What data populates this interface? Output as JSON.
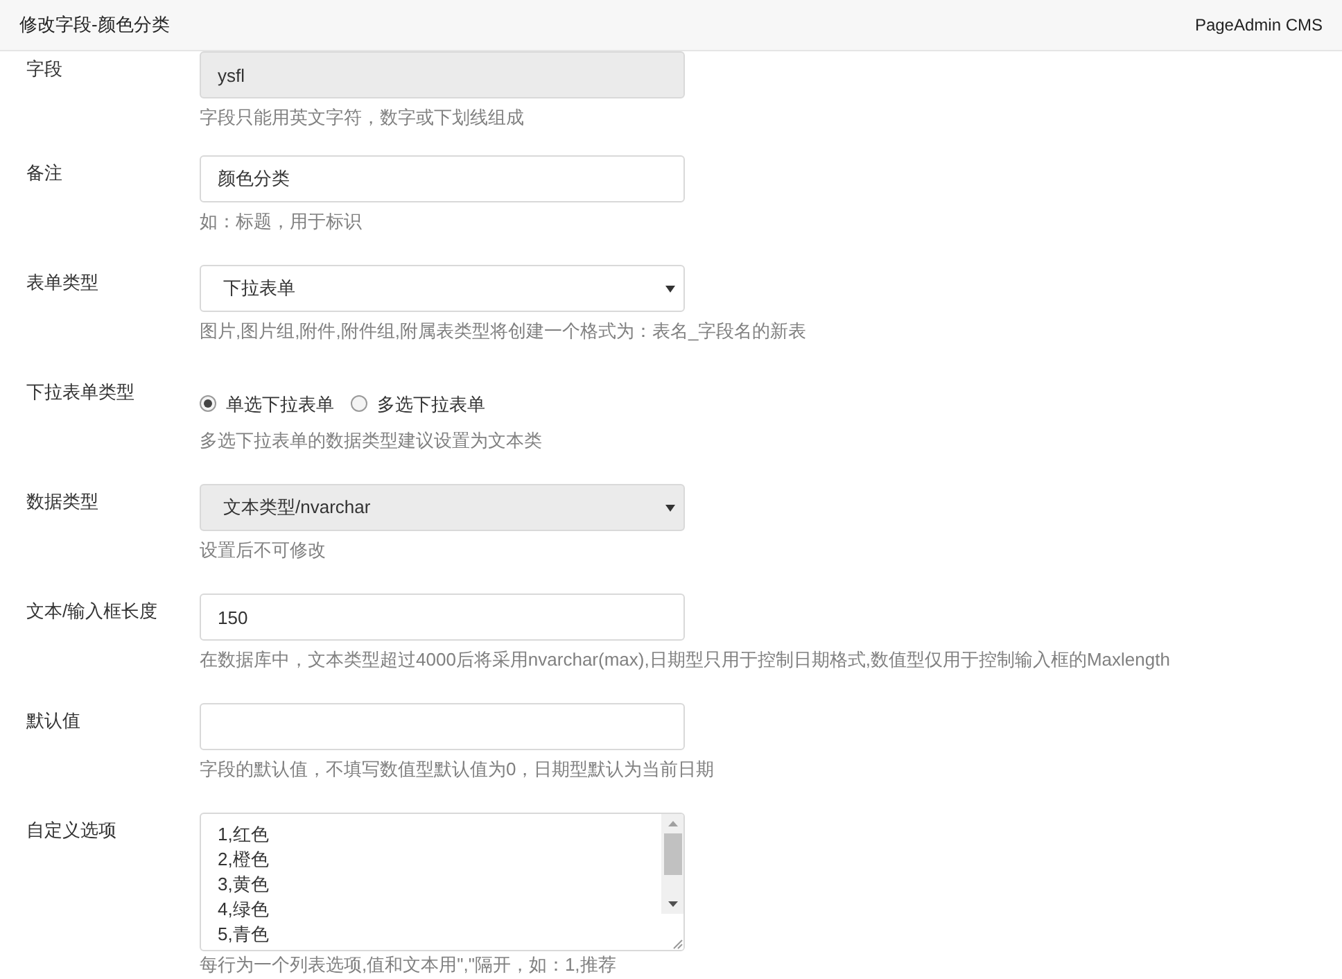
{
  "header": {
    "title": "修改字段-颜色分类",
    "brand": "PageAdmin CMS"
  },
  "fields": [
    {
      "kind": "text",
      "label": "字段",
      "value": "ysfl",
      "disabled": true,
      "hint": "字段只能用英文字符，数字或下划线组成"
    },
    {
      "kind": "text",
      "label": "备注",
      "value": "颜色分类",
      "disabled": false,
      "hint": "如：标题，用于标识"
    },
    {
      "kind": "select",
      "label": "表单类型",
      "value": "下拉表单",
      "disabled": false,
      "hint": "图片,图片组,附件,附件组,附属表类型将创建一个格式为：表名_字段名的新表"
    },
    {
      "kind": "radio",
      "label": "下拉表单类型",
      "options": [
        {
          "label": "单选下拉表单",
          "selected": true
        },
        {
          "label": "多选下拉表单",
          "selected": false
        }
      ],
      "hint": "多选下拉表单的数据类型建议设置为文本类"
    },
    {
      "kind": "select",
      "label": "数据类型",
      "value": "文本类型/nvarchar",
      "disabled": true,
      "hint": "设置后不可修改"
    },
    {
      "kind": "text",
      "label": "文本/输入框长度",
      "value": "150",
      "disabled": false,
      "hint": "在数据库中，文本类型超过4000后将采用nvarchar(max),日期型只用于控制日期格式,数值型仅用于控制输入框的Maxlength"
    },
    {
      "kind": "text",
      "label": "默认值",
      "disabled": false,
      "hint": "字段的默认值，不填写数值型默认值为0，日期型默认为当前日期"
    },
    {
      "kind": "textarea",
      "label": "自定义选项",
      "lines": [
        "1,红色",
        "2,橙色",
        "3,黄色",
        "4,绿色",
        "5,青色"
      ],
      "hint": "每行为一个列表选项,值和文本用\",\"隔开，如：1,推荐"
    }
  ]
}
